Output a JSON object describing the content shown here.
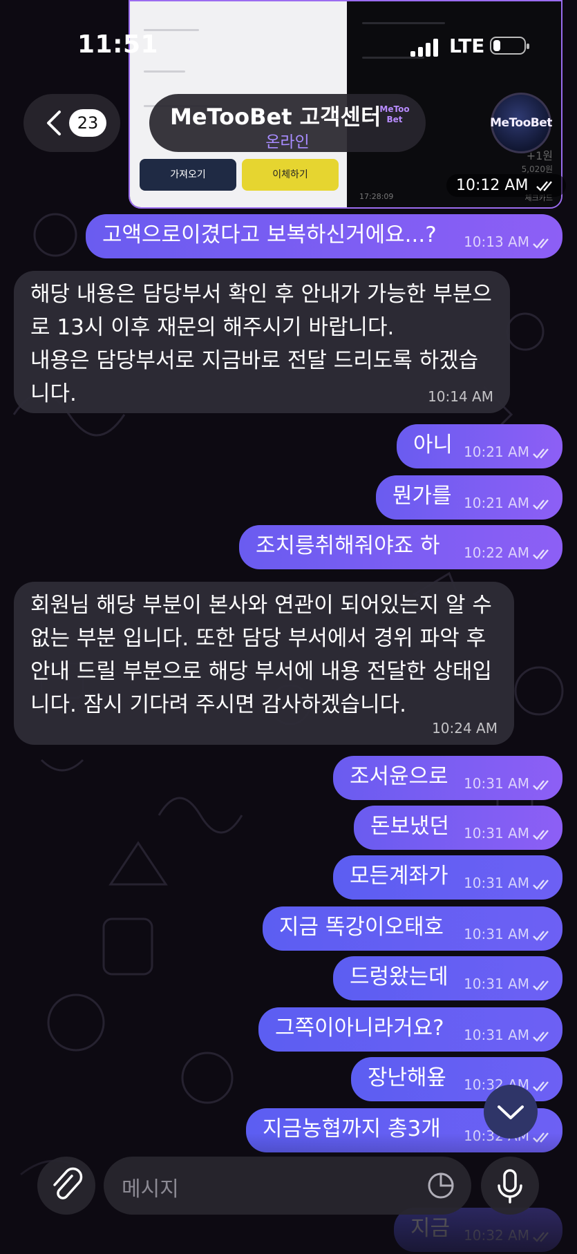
{
  "status_bar": {
    "time": "11:51",
    "network": "LTE"
  },
  "header": {
    "back_count": "23",
    "title": "MeTooBet 고객센터",
    "badge_text": "MeToo Bet",
    "status": "온라인",
    "avatar_text": "MeTooBet"
  },
  "media": {
    "time": "10:12 AM",
    "button_left": "가져오기",
    "button_right": "이체하기",
    "right_time": "17:28:09",
    "right_amount": "+1원",
    "right_balance": "5,020원",
    "right_card": "체크카드"
  },
  "messages": [
    {
      "id": "m1",
      "dir": "out",
      "text": "고액으로이겼다고 보복하신거에요...?",
      "time": "10:13 AM"
    },
    {
      "id": "m2",
      "dir": "in",
      "text": "해당 내용은 담당부서 확인 후 안내가 가능한 부분으로 13시 이후 재문의 해주시기 바랍니다.\n내용은 담당부서로 지금바로 전달 드리도록 하겠습니다.",
      "time": "10:14 AM"
    },
    {
      "id": "m3",
      "dir": "out",
      "text": "아니",
      "time": "10:21 AM"
    },
    {
      "id": "m4",
      "dir": "out",
      "text": "뭔가를",
      "time": "10:21 AM"
    },
    {
      "id": "m5",
      "dir": "out",
      "text": "조치릉취해줘야죠 하",
      "time": "10:22 AM"
    },
    {
      "id": "m6",
      "dir": "in",
      "text": "회원님 해당 부분이 본사와 연관이 되어있는지 알 수 없는 부분 입니다. 또한 담당 부서에서 경위 파악 후 안내 드릴 부분으로 해당 부서에 내용 전달한 상태입니다. 잠시 기다려 주시면 감사하겠습니다.",
      "time": "10:24 AM"
    },
    {
      "id": "m7",
      "dir": "out",
      "text": "조서윤으로",
      "time": "10:31 AM"
    },
    {
      "id": "m8",
      "dir": "out",
      "text": "돈보냈던",
      "time": "10:31 AM"
    },
    {
      "id": "m9",
      "dir": "out",
      "text": "모든계좌가",
      "time": "10:31 AM"
    },
    {
      "id": "m10",
      "dir": "out",
      "text": "지금 똑강이오태호",
      "time": "10:31 AM"
    },
    {
      "id": "m11",
      "dir": "out",
      "text": "드렁왔는데",
      "time": "10:31 AM"
    },
    {
      "id": "m12",
      "dir": "out",
      "text": "그쪽이아니라거요?",
      "time": "10:31 AM"
    },
    {
      "id": "m13",
      "dir": "out",
      "text": "장난해욮",
      "time": "10:32 AM"
    },
    {
      "id": "m14",
      "dir": "out",
      "text": "지금농협까지 총3개",
      "time": "10:32 AM"
    },
    {
      "id": "m15",
      "dir": "out",
      "text": "지금",
      "time": "10:32 AM"
    }
  ],
  "composer": {
    "placeholder": "메시지"
  },
  "colors": {
    "accent": "#8d5ff5",
    "status": "#a88cff",
    "bubble_in": "#2e2c36"
  }
}
